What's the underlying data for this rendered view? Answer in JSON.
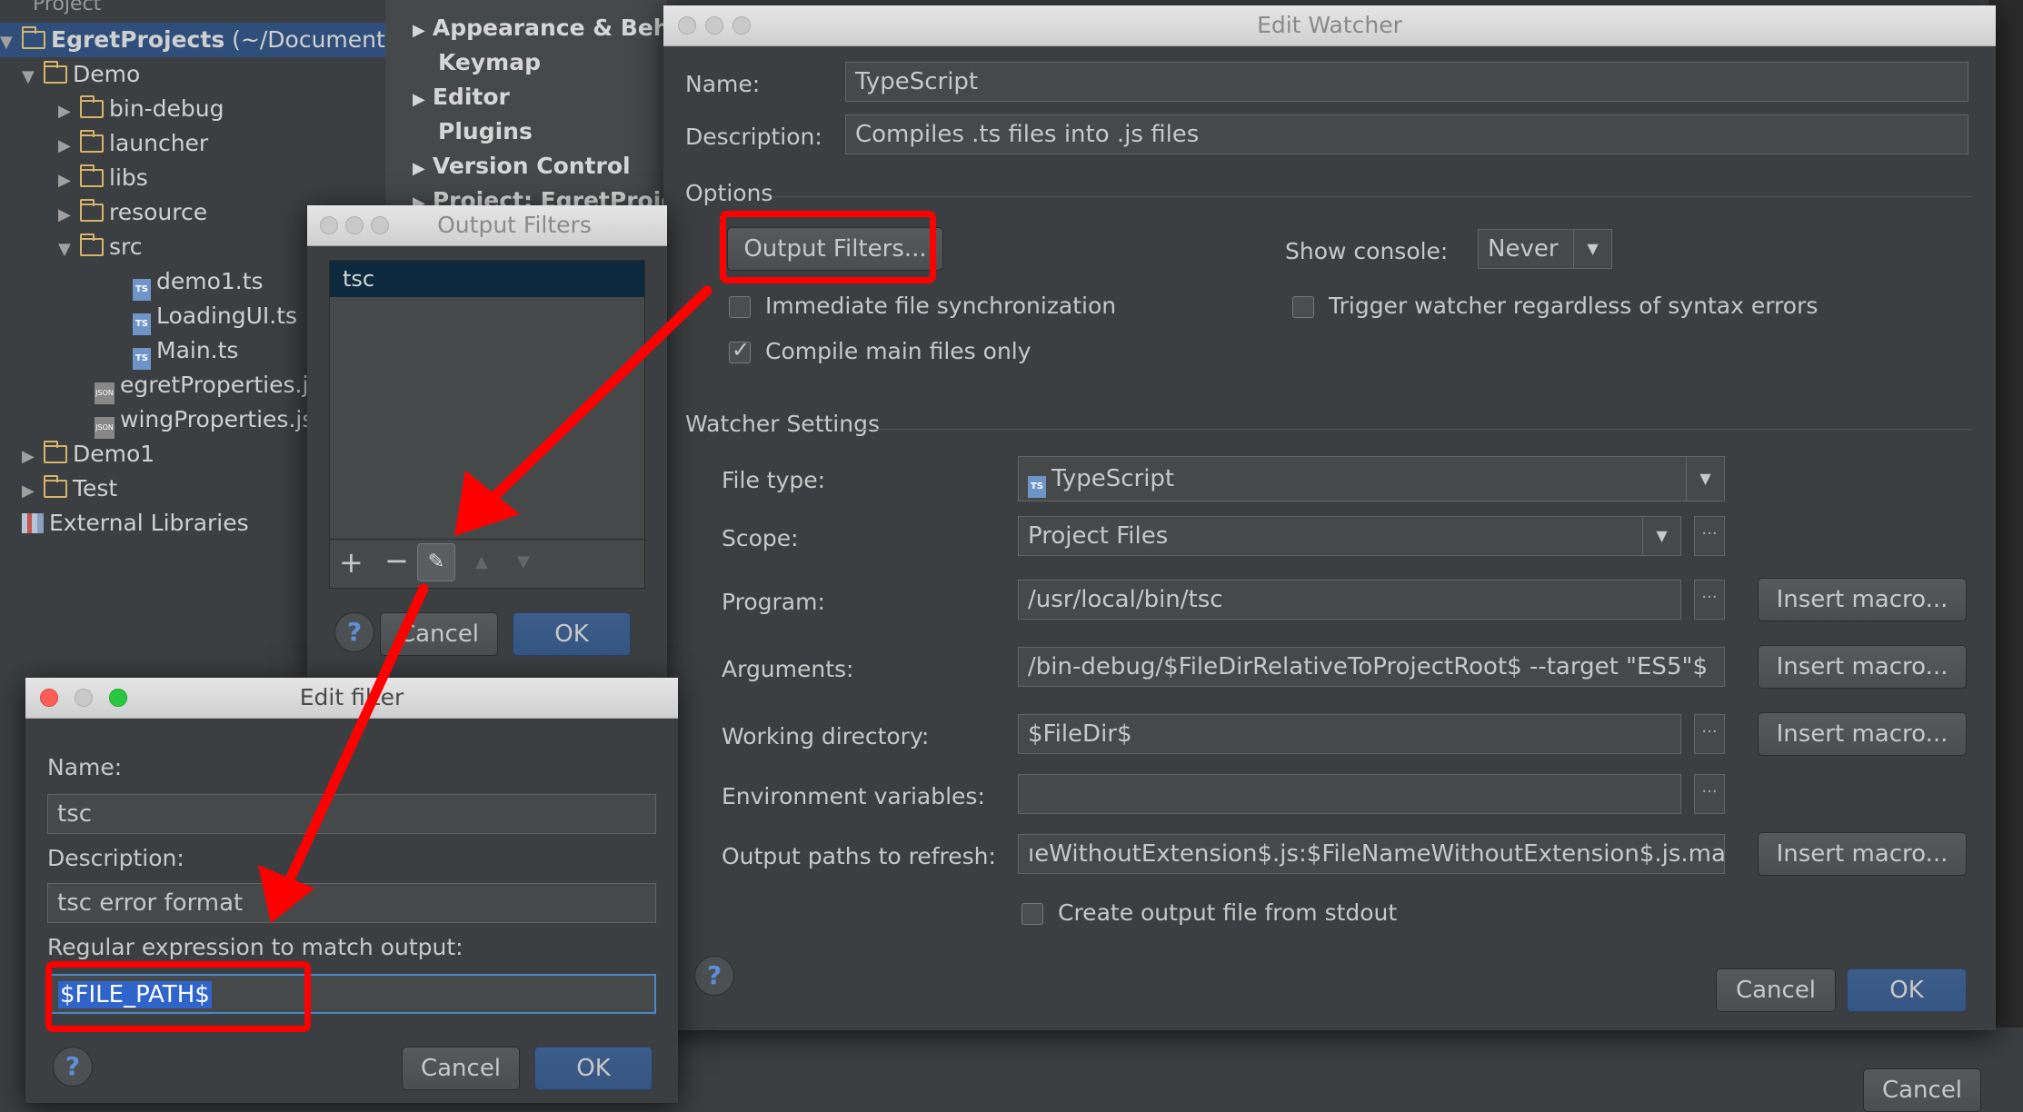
{
  "project_tree": {
    "header": "Project",
    "root": "EgretProjects",
    "root_path": "(~/Documents/Eg",
    "items": [
      {
        "label": "Demo"
      },
      {
        "label": "bin-debug"
      },
      {
        "label": "launcher"
      },
      {
        "label": "libs"
      },
      {
        "label": "resource"
      },
      {
        "label": "src"
      },
      {
        "label": "demo1.ts"
      },
      {
        "label": "LoadingUI.ts"
      },
      {
        "label": "Main.ts"
      },
      {
        "label": "egretProperties.js"
      },
      {
        "label": "wingProperties.js"
      },
      {
        "label": "Demo1"
      },
      {
        "label": "Test"
      },
      {
        "label": "External Libraries"
      }
    ]
  },
  "settings_tree": {
    "items": [
      "Appearance & Behav",
      "Keymap",
      "Editor",
      "Plugins",
      "Version Control",
      "Project: EgretProject"
    ]
  },
  "edit_watcher": {
    "title": "Edit Watcher",
    "name_label": "Name:",
    "name_value": "TypeScript",
    "description_label": "Description:",
    "description_value": "Compiles .ts files into .js files",
    "options_header": "Options",
    "output_filters_button": "Output Filters...",
    "show_console_label": "Show console:",
    "show_console_value": "Never",
    "immediate_sync_label": "Immediate file synchronization",
    "trigger_label": "Trigger watcher regardless of syntax errors",
    "compile_main_label": "Compile main files only",
    "watcher_settings_header": "Watcher Settings",
    "file_type_label": "File type:",
    "file_type_value": "TypeScript",
    "scope_label": "Scope:",
    "scope_value": "Project Files",
    "program_label": "Program:",
    "program_value": "/usr/local/bin/tsc",
    "arguments_label": "Arguments:",
    "arguments_value": "/bin-debug/$FileDirRelativeToProjectRoot$  --target \"ES5\"$",
    "working_dir_label": "Working directory:",
    "working_dir_value": "$FileDir$",
    "env_label": "Environment variables:",
    "env_value": "",
    "output_paths_label": "Output paths to refresh:",
    "output_paths_value": "ıeWithoutExtension$.js:$FileNameWithoutExtension$.js.map",
    "create_output_label": "Create output file from stdout",
    "insert_macro": "Insert macro...",
    "cancel": "Cancel",
    "ok": "OK"
  },
  "output_filters": {
    "title": "Output Filters",
    "items": [
      "tsc"
    ],
    "cancel": "Cancel",
    "ok": "OK"
  },
  "edit_filter": {
    "title": "Edit filter",
    "name_label": "Name:",
    "name_value": "tsc",
    "description_label": "Description:",
    "description_value": "tsc error format",
    "regex_label": "Regular expression to match output:",
    "regex_value": "$FILE_PATH$",
    "cancel": "Cancel",
    "ok": "OK"
  },
  "background": {
    "cancel": "Cancel"
  },
  "help_glyph": "?",
  "colors": {
    "accent": "#3c5d8a",
    "annotation_red": "#ff0000",
    "selection": "#2f65ca"
  }
}
